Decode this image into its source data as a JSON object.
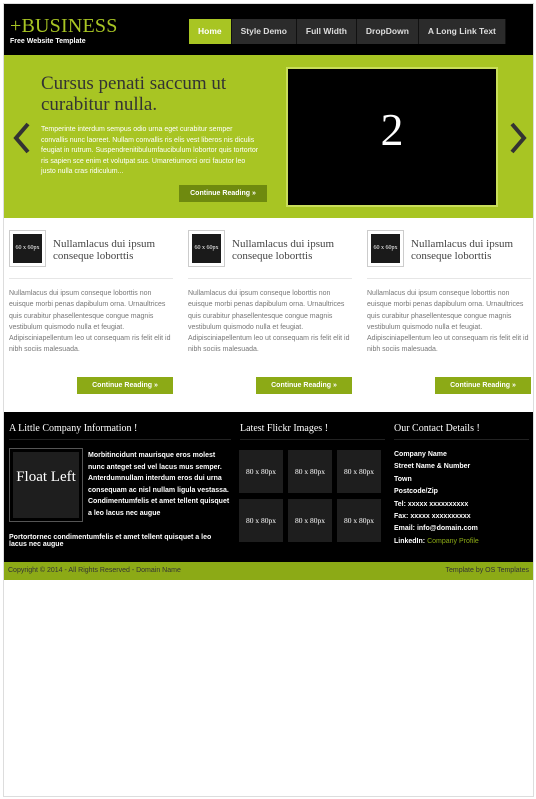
{
  "header": {
    "logo": "+BUSINESS",
    "tagline": "Free Website Template",
    "nav": [
      {
        "label": "Home",
        "active": true
      },
      {
        "label": "Style Demo",
        "active": false
      },
      {
        "label": "Full Width",
        "active": false
      },
      {
        "label": "DropDown",
        "active": false
      },
      {
        "label": "A Long Link Text",
        "active": false
      }
    ]
  },
  "slider": {
    "title": "Cursus penati saccum ut curabitur nulla.",
    "text": "Temperinte interdum sempus odio urna eget curabitur semper convallis nunc laoreet. Nullam convallis ris elis vest liberos nis diculis feugiat in rutrum. Suspendrenitibulumfaucibulum lobortor quis tortortor ris sapien sce enim et volutpat sus. Umaretiumorci orci fauctor leo justo nulla cras ridiculum...",
    "button": "Continue Reading »",
    "image_label": "2",
    "prev_icon": "chevron-left-icon",
    "next_icon": "chevron-right-icon"
  },
  "features": [
    {
      "thumb": "60 x 60px",
      "title": "Nullamlacus dui ipsum conseque loborttis",
      "text": "Nullamlacus dui ipsum conseque loborttis non euisque morbi penas dapibulum orna. Urnaultrices quis curabitur phasellentesque congue magnis vestibulum quismodo nulla et feugiat. Adipisciniapellentum leo ut consequam ris felit elit id nibh sociis malesuada.",
      "button": "Continue Reading »"
    },
    {
      "thumb": "60 x 60px",
      "title": "Nullamlacus dui ipsum conseque loborttis",
      "text": "Nullamlacus dui ipsum conseque loborttis non euisque morbi penas dapibulum orna. Urnaultrices quis curabitur phasellentesque congue magnis vestibulum quismodo nulla et feugiat. Adipisciniapellentum leo ut consequam ris felit elit id nibh sociis malesuada.",
      "button": "Continue Reading »"
    },
    {
      "thumb": "60 x 60px",
      "title": "Nullamlacus dui ipsum conseque loborttis",
      "text": "Nullamlacus dui ipsum conseque loborttis non euisque morbi penas dapibulum orna. Urnaultrices quis curabitur phasellentesque congue magnis vestibulum quismodo nulla et feugiat. Adipisciniapellentum leo ut consequam ris felit elit id nibh sociis malesuada.",
      "button": "Continue Reading »"
    }
  ],
  "footer": {
    "company": {
      "title": "A Little Company Information !",
      "float_label": "Float Left",
      "text": "Morbitincidunt maurisque eros molest nunc anteget sed vel lacus mus semper. Anterdumnullam interdum eros dui urna consequam ac nisl nullam ligula vestassa. Condimentumfelis et amet tellent quisquet a leo lacus nec augue",
      "last": "Portortornec condimentumfelis et amet tellent quisquet a leo lacus nec augue"
    },
    "flickr": {
      "title": "Latest Flickr Images !",
      "images": [
        "80 x 80px",
        "80 x 80px",
        "80 x 80px",
        "80 x 80px",
        "80 x 80px",
        "80 x 80px"
      ]
    },
    "contact": {
      "title": "Our Contact Details !",
      "company_name": "Company Name",
      "street": "Street Name & Number",
      "town": "Town",
      "postcode": "Postcode/Zip",
      "tel": "Tel: xxxxx xxxxxxxxxx",
      "fax": "Fax: xxxxx xxxxxxxxxx",
      "email": "Email: info@domain.com",
      "linkedin_label": "LinkedIn:",
      "linkedin_link": "Company Profile"
    }
  },
  "bottom": {
    "copyright": "Copyright © 2014 - All Rights Reserved - Domain Name",
    "credit": "Template by OS Templates"
  },
  "colors": {
    "accent": "#a8c523",
    "accent_dark": "#8caa16",
    "header_bg": "#000000"
  }
}
